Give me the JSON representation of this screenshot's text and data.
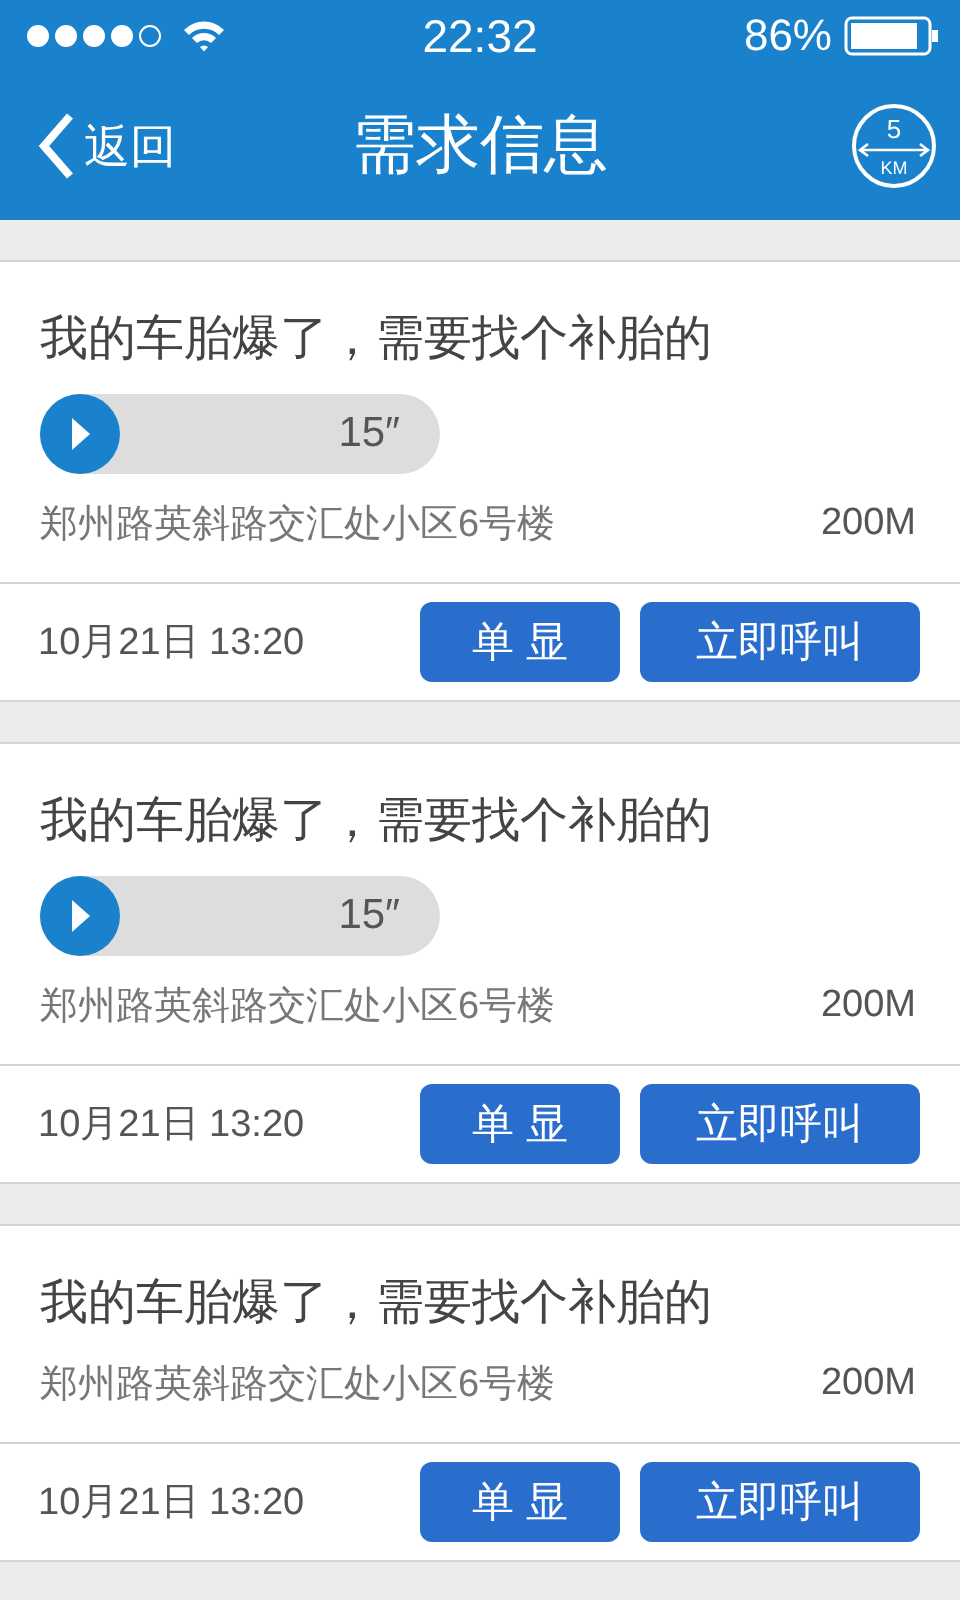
{
  "status_bar": {
    "time": "22:32",
    "battery": "86%"
  },
  "nav": {
    "back": "返回",
    "title": "需求信息",
    "range": {
      "value": "5",
      "unit": "KM"
    }
  },
  "requests": [
    {
      "title": "我的车胎爆了，需要找个补胎的",
      "voice": {
        "duration": "15″"
      },
      "address": "郑州路英斜路交汇处小区6号楼",
      "distance": "200M",
      "time": "10月21日 13:20",
      "actions": [
        "单 显",
        "立即呼叫"
      ]
    },
    {
      "title": "我的车胎爆了，需要找个补胎的",
      "voice": {
        "duration": "15″"
      },
      "address": "郑州路英斜路交汇处小区6号楼",
      "distance": "200M",
      "time": "10月21日 13:20",
      "actions": [
        "单 显",
        "立即呼叫"
      ]
    },
    {
      "title": "我的车胎爆了，需要找个补胎的",
      "address": "郑州路英斜路交汇处小区6号楼",
      "distance": "200M",
      "time": "10月21日 13:20",
      "actions": [
        "单 显",
        "立即呼叫"
      ]
    }
  ]
}
